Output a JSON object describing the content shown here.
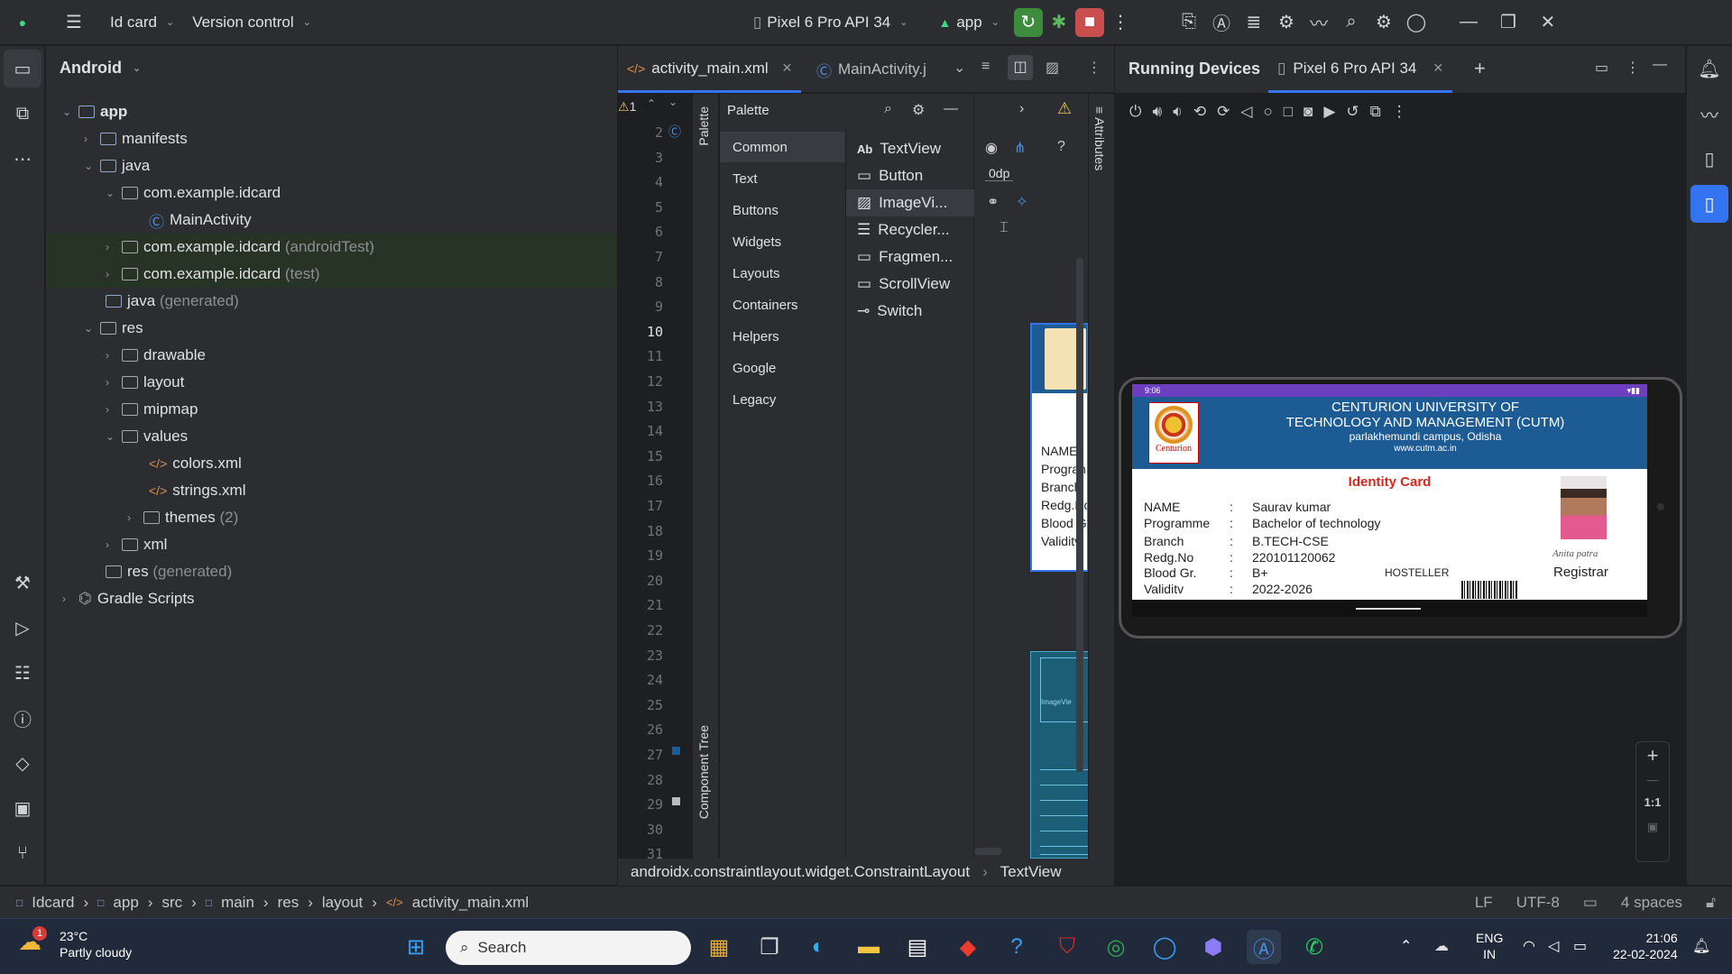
{
  "titlebar": {
    "project": "Id card",
    "vcs": "Version control",
    "device": "Pixel 6 Pro API 34",
    "run_config": "app"
  },
  "project_panel": {
    "view": "Android",
    "tree": [
      {
        "label": "app",
        "suffix": ""
      },
      {
        "label": "manifests",
        "suffix": ""
      },
      {
        "label": "java",
        "suffix": ""
      },
      {
        "label": "com.example.idcard",
        "suffix": ""
      },
      {
        "label": "MainActivity",
        "suffix": ""
      },
      {
        "label": "com.example.idcard",
        "suffix": "(androidTest)"
      },
      {
        "label": "com.example.idcard",
        "suffix": "(test)"
      },
      {
        "label": "java",
        "suffix": "(generated)"
      },
      {
        "label": "res",
        "suffix": ""
      },
      {
        "label": "drawable",
        "suffix": ""
      },
      {
        "label": "layout",
        "suffix": ""
      },
      {
        "label": "mipmap",
        "suffix": ""
      },
      {
        "label": "values",
        "suffix": ""
      },
      {
        "label": "colors.xml",
        "suffix": ""
      },
      {
        "label": "strings.xml",
        "suffix": ""
      },
      {
        "label": "themes",
        "suffix": "(2)"
      },
      {
        "label": "xml",
        "suffix": ""
      },
      {
        "label": "res",
        "suffix": "(generated)"
      },
      {
        "label": "Gradle Scripts",
        "suffix": ""
      }
    ]
  },
  "editor": {
    "tabs": [
      "activity_main.xml",
      "MainActivity.j"
    ],
    "warning_count": "1",
    "line_numbers": [
      "2",
      "3",
      "4",
      "5",
      "6",
      "7",
      "8",
      "9",
      "10",
      "11",
      "12",
      "13",
      "14",
      "15",
      "16",
      "17",
      "18",
      "19",
      "20",
      "21",
      "22",
      "23",
      "24",
      "25",
      "26",
      "27",
      "28",
      "29",
      "30",
      "31"
    ],
    "breadcrumb": [
      "androidx.constraintlayout.widget.ConstraintLayout",
      "TextView"
    ]
  },
  "palette": {
    "title": "Palette",
    "side_label": "Palette",
    "tree_label": "Component Tree",
    "attributes_label": "Attributes",
    "categories": [
      "Common",
      "Text",
      "Buttons",
      "Widgets",
      "Layouts",
      "Containers",
      "Helpers",
      "Google",
      "Legacy"
    ],
    "items": [
      "TextView",
      "Button",
      "ImageVi...",
      "Recycler...",
      "Fragmen...",
      "ScrollView",
      "Switch"
    ],
    "margin_value": "0dp"
  },
  "design_preview": {
    "labels": [
      "NAME",
      "Progran",
      "Branch",
      "Redg.Nc",
      "Blood G",
      "Validitv"
    ],
    "image_label": "ImageVie"
  },
  "running_devices": {
    "title": "Running Devices",
    "device_tab": "Pixel 6 Pro API 34",
    "zoom_label": "1:1"
  },
  "phone_screen": {
    "time": "9:06",
    "university": [
      "CENTURION UNIVERSITY OF",
      "TECHNOLOGY AND MANAGEMENT (CUTM)"
    ],
    "campus": "parlakhemundi campus, Odisha",
    "website": "www.cutm.ac.in",
    "logo_text": "Centurion",
    "card_title": "Identity Card",
    "fields": [
      {
        "label": "NAME",
        "value": "Saurav kumar"
      },
      {
        "label": "Programme",
        "value": "Bachelor of technology"
      },
      {
        "label": "Branch",
        "value": "B.TECH-CSE"
      },
      {
        "label": "Redg.No",
        "value": "220101120062"
      },
      {
        "label": "Blood Gr.",
        "value": "B+"
      },
      {
        "label": "Validitv",
        "value": "2022-2026"
      }
    ],
    "separator": ":",
    "hosteller": "HOSTELLER",
    "signature": "Anita patra",
    "registrar": "Registrar"
  },
  "statusbar": {
    "path": [
      "Idcard",
      "app",
      "src",
      "main",
      "res",
      "layout",
      "activity_main.xml"
    ],
    "line_sep": "LF",
    "encoding": "UTF-8",
    "indent": "4 spaces"
  },
  "taskbar": {
    "weather_temp": "23°C",
    "weather_desc": "Partly cloudy",
    "weather_badge": "1",
    "search": "Search",
    "lang1": "ENG",
    "lang2": "IN",
    "time": "21:06",
    "date": "22-02-2024"
  },
  "colors": {
    "ide_bg": "#1e1f22",
    "panel_bg": "#2b2d30",
    "accent": "#3574f0",
    "card_header": "#1d5b94",
    "card_title": "#d6261f"
  }
}
